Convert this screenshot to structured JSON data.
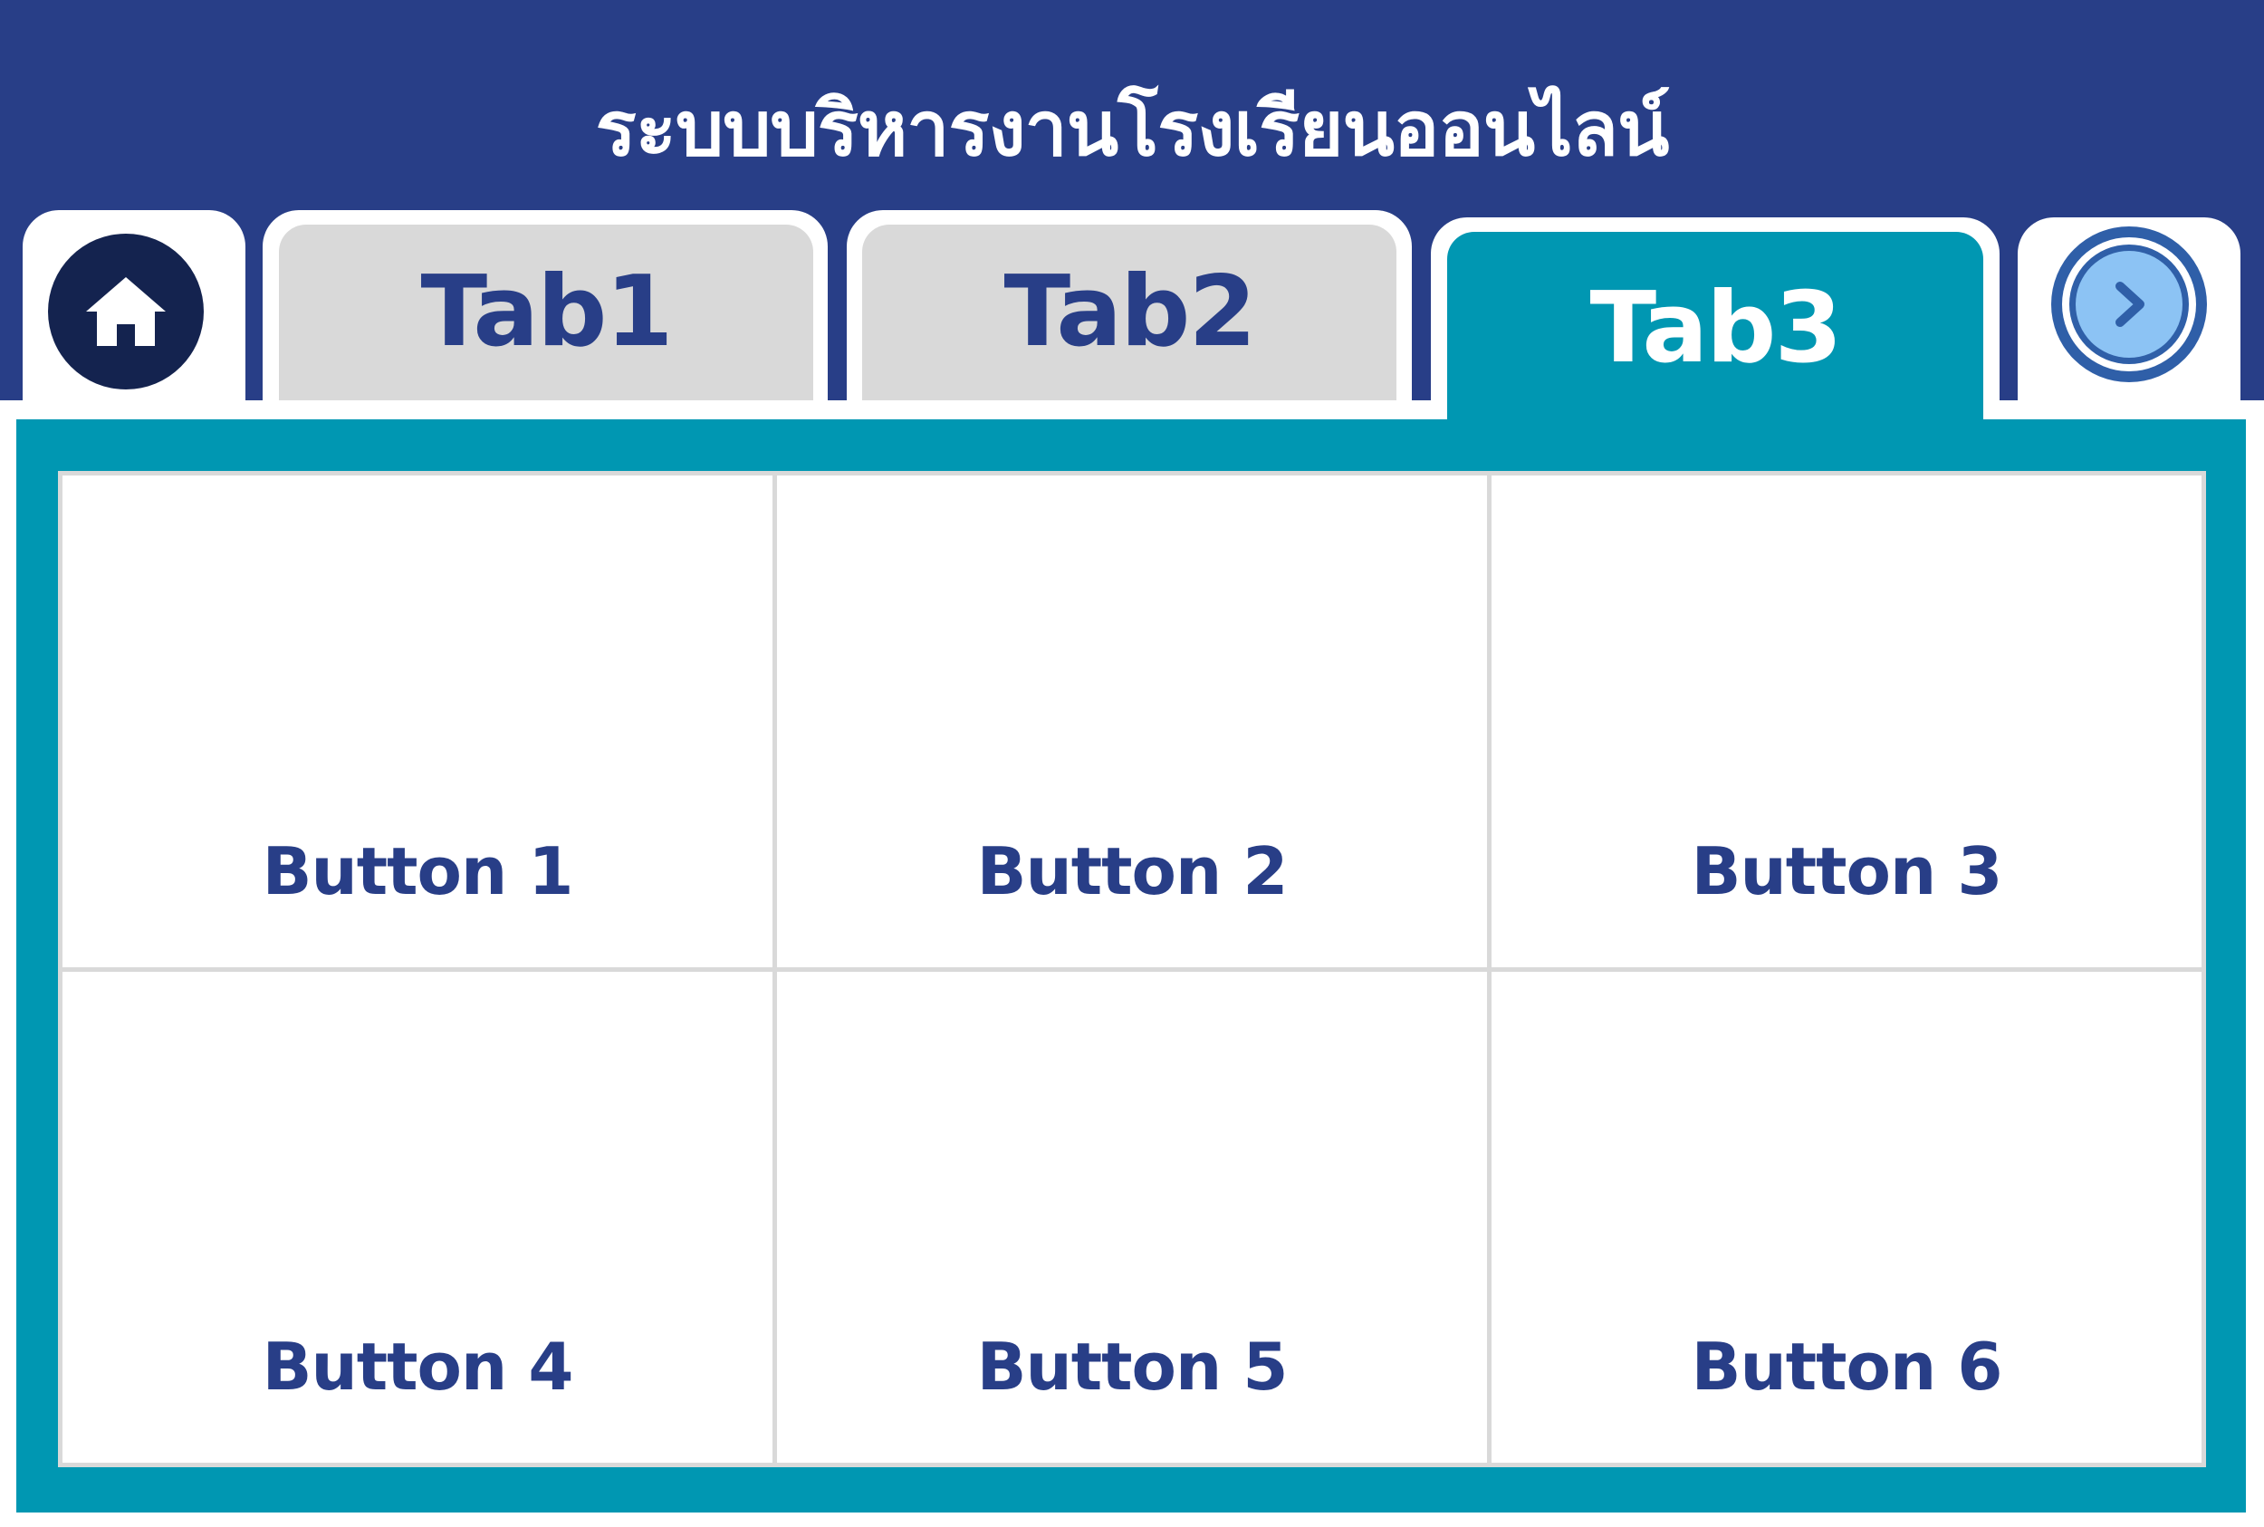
{
  "header": {
    "title": "ระบบบริหารงานโรงเรียนออนไลน์"
  },
  "nav": {
    "home_icon": "home-icon",
    "next_icon": "chevron-right-circle-icon",
    "tabs": [
      {
        "label": "Tab1",
        "active": false
      },
      {
        "label": "Tab2",
        "active": false
      },
      {
        "label": "Tab3",
        "active": true
      }
    ]
  },
  "grid": {
    "buttons": [
      {
        "label": "Button 1"
      },
      {
        "label": "Button 2"
      },
      {
        "label": "Button 3"
      },
      {
        "label": "Button 4"
      },
      {
        "label": "Button 5"
      },
      {
        "label": "Button 6"
      }
    ]
  },
  "colors": {
    "header_bg": "#283e87",
    "active_tab": "#0097b2",
    "inactive_tab": "#d9d9d9",
    "text_dark": "#283e87",
    "home_button": "#14234f",
    "next_button_fill": "#8cc3f4"
  }
}
